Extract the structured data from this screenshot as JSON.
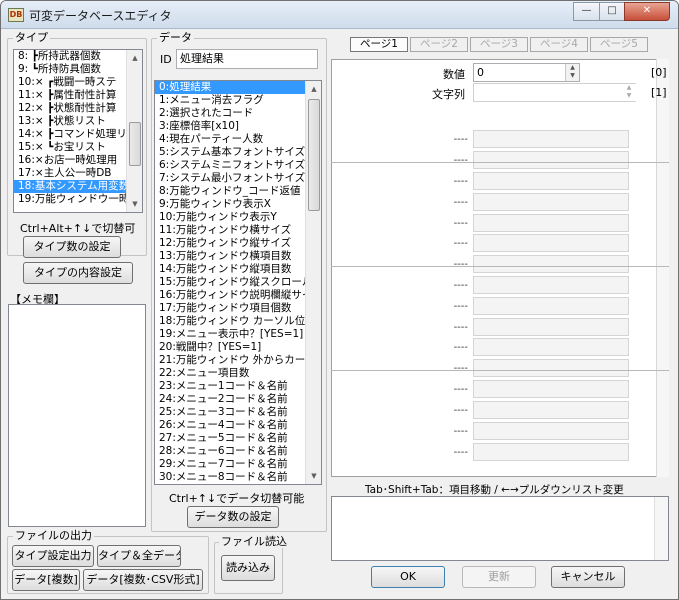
{
  "window": {
    "title": "可変データベースエディタ",
    "app_icon_text": "DB",
    "minimize_glyph": "—",
    "maximize_glyph": "□",
    "close_glyph": "✕"
  },
  "type_group": {
    "legend": "タイプ",
    "items": [
      "8: ┣所持武器個数",
      "9: ┗所持防具個数",
      "10:× ┏戦闘一時ステ",
      "11:× ┣属性耐性計算",
      "12:× ┣状態耐性計算",
      "13:× ┣状態リスト",
      "14:× ┣コマンド処理リス",
      "15:× ┗お宝リスト",
      "16:×お店一時処理用",
      "17:×主人公一時DB",
      "18:基本システム用変数",
      "19:万能ウィンドウ一時DB"
    ],
    "selected_index": 10,
    "hint": "Ctrl+Alt+↑↓で切替可",
    "btn_set_count": "タイプ数の設定",
    "btn_set_content": "タイプの内容設定"
  },
  "memo": {
    "label": "【メモ欄】"
  },
  "data_group": {
    "legend": "データ",
    "id_label": "ID",
    "id_value": "処理結果",
    "items": [
      "0:処理結果",
      "1:メニュー消去フラグ",
      "2:選択されたコード",
      "3:座標倍率[x10]",
      "4:現在パーティー人数",
      "5:システム基本フォントサイズ",
      "6:システムミニフォントサイズ",
      "7:システム最小フォントサイズ",
      "8:万能ウィンドウ_コード返値",
      "9:万能ウィンドウ表示X",
      "10:万能ウィンドウ表示Y",
      "11:万能ウィンドウ横サイズ",
      "12:万能ウィンドウ縦サイズ",
      "13:万能ウィンドウ横項目数",
      "14:万能ウィンドウ縦項目数",
      "15:万能ウィンドウ縦スクロール[",
      "16:万能ウィンドウ説明欄縦サイ",
      "17:万能ウィンドウ項目個数",
      "18:万能ウィンドウ カーソル位置",
      "19:メニュー表示中？[YES=1]",
      "20:戦闘中？[YES=1]",
      "21:万能ウィンドウ 外からカーソ",
      "22:メニュー項目数",
      "23:メニュー1コード＆名前",
      "24:メニュー2コード＆名前",
      "25:メニュー3コード＆名前",
      "26:メニュー4コード＆名前",
      "27:メニュー5コード＆名前",
      "28:メニュー6コード＆名前",
      "29:メニュー7コード＆名前",
      "30:メニュー8コード＆名前"
    ],
    "selected_index": 0,
    "hint": "Ctrl+↑↓でデータ切替可能",
    "btn_set_count": "データ数の設定"
  },
  "tabs": [
    "ページ1",
    "ページ2",
    "ページ3",
    "ページ4",
    "ページ5"
  ],
  "active_tab": 0,
  "fields": {
    "numeric_label": "数値",
    "numeric_value": "0",
    "numeric_index": "[0]",
    "string_label": "文字列",
    "string_value": "",
    "string_index": "[1]",
    "empty_marker": "----"
  },
  "nav_hint": "Tab･Shift+Tab：項目移動 / ←→プルダウンリスト変更",
  "file_output": {
    "legend": "ファイルの出力",
    "btn_type_settings": "タイプ設定出力",
    "btn_type_all": "タイプ＆全データ",
    "btn_data_multi": "データ[複数]",
    "btn_data_csv": "データ[複数･CSV形式]"
  },
  "file_read": {
    "legend": "ファイル読込",
    "btn_read": "読み込み"
  },
  "footer": {
    "ok": "OK",
    "update": "更新",
    "cancel": "キャンセル"
  }
}
